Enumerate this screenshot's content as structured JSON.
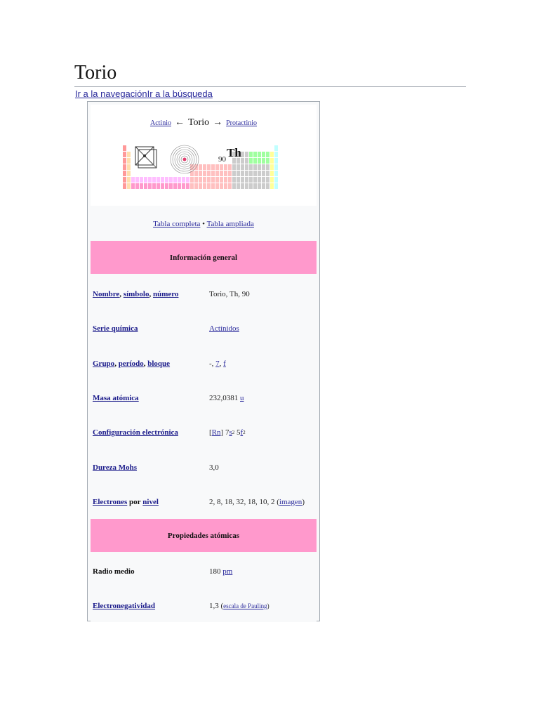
{
  "page": {
    "title": "Torio",
    "skip_nav": "Ir a la navegación",
    "skip_search": "Ir a la búsqueda"
  },
  "nav": {
    "prev": "Actinio",
    "prev_arrow": "←",
    "current": "Torio",
    "next_arrow": "→",
    "next": "Protactinio"
  },
  "element": {
    "number": "90",
    "symbol": "Th"
  },
  "table_links": {
    "full": "Tabla completa",
    "bullet": "•",
    "extended": "Tabla ampliada"
  },
  "sections": {
    "general": "Información general",
    "atomic": "Propiedades atómicas"
  },
  "rows": {
    "name": {
      "k1": "Nombre",
      "k2": "símbolo",
      "k3": "número",
      "value": "Torio, Th, 90"
    },
    "series": {
      "key": "Serie química",
      "value": "Actínidos"
    },
    "group": {
      "k1": "Grupo",
      "k2": "período",
      "k3": "bloque",
      "v_plain": "-, ",
      "v_period": "7",
      "v_block": "f"
    },
    "mass": {
      "key": "Masa atómica",
      "value": "232,0381",
      "unit": "u"
    },
    "config": {
      "key": "Configuración electrónica",
      "core": "Rn",
      "s": "s",
      "f": "f",
      "n7": "7",
      "e2a": "2",
      "n5": "5",
      "e2b": "2"
    },
    "mohs": {
      "key": "Dureza Mohs",
      "value": "3,0"
    },
    "shells": {
      "k1": "Electrones",
      "kmid": "por",
      "k2": "nivel",
      "value": "2, 8, 18, 32, 18, 10, 2 (",
      "image": "imagen",
      "close": ")"
    },
    "radius": {
      "key": "Radio medio",
      "value": "180",
      "unit": "pm"
    },
    "electroneg": {
      "key": "Electronegatividad",
      "value": "1,3 (",
      "scale": "escala de Pauling",
      "close": ")"
    }
  },
  "colors": {
    "section_bg": "#ff99cc",
    "link": "#2a2a9c",
    "border": "#a2a9b1"
  }
}
